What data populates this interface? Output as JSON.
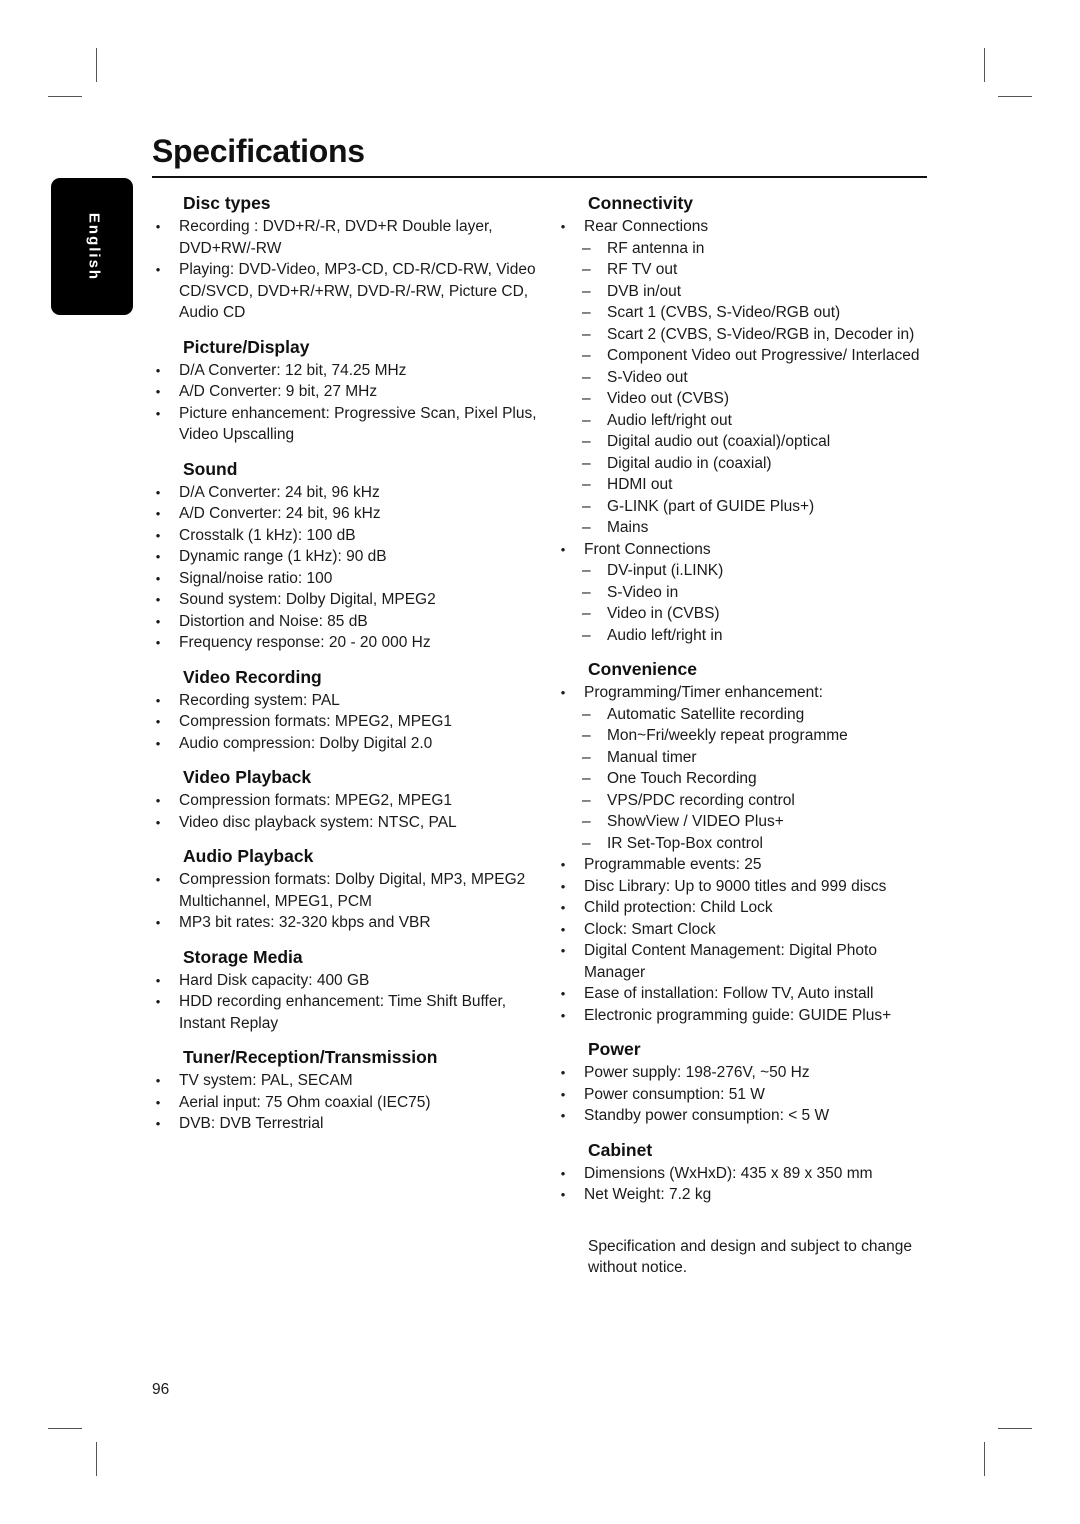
{
  "page": {
    "title": "Specifications",
    "language_tab": "English",
    "page_number": "96",
    "note": "Specification and design and subject to change without notice."
  },
  "left_sections": [
    {
      "heading": "Disc types",
      "items": [
        {
          "text": "Recording : DVD+R/-R, DVD+R Double layer, DVD+RW/-RW"
        },
        {
          "text": "Playing: DVD-Video, MP3-CD, CD-R/CD-RW, Video CD/SVCD, DVD+R/+RW, DVD-R/-RW, Picture CD, Audio CD"
        }
      ]
    },
    {
      "heading": "Picture/Display",
      "items": [
        {
          "text": "D/A Converter: 12 bit, 74.25 MHz"
        },
        {
          "text": "A/D Converter: 9 bit, 27 MHz"
        },
        {
          "text": "Picture enhancement: Progressive Scan, Pixel Plus, Video Upscalling"
        }
      ]
    },
    {
      "heading": "Sound",
      "items": [
        {
          "text": "D/A Converter: 24 bit, 96 kHz"
        },
        {
          "text": "A/D Converter: 24 bit, 96 kHz"
        },
        {
          "text": "Crosstalk (1 kHz): 100 dB"
        },
        {
          "text": "Dynamic range (1 kHz): 90 dB"
        },
        {
          "text": "Signal/noise ratio: 100"
        },
        {
          "text": "Sound system: Dolby Digital, MPEG2"
        },
        {
          "text": "Distortion and Noise: 85 dB"
        },
        {
          "text": "Frequency response: 20 - 20 000 Hz"
        }
      ]
    },
    {
      "heading": "Video Recording",
      "items": [
        {
          "text": "Recording system: PAL"
        },
        {
          "text": "Compression formats: MPEG2, MPEG1"
        },
        {
          "text": "Audio compression: Dolby Digital 2.0"
        }
      ]
    },
    {
      "heading": "Video Playback",
      "items": [
        {
          "text": "Compression formats: MPEG2, MPEG1"
        },
        {
          "text": "Video disc playback system: NTSC, PAL"
        }
      ]
    },
    {
      "heading": "Audio Playback",
      "items": [
        {
          "text": "Compression formats: Dolby Digital, MP3, MPEG2 Multichannel, MPEG1, PCM"
        },
        {
          "text": "MP3 bit rates: 32-320 kbps and VBR"
        }
      ]
    },
    {
      "heading": "Storage Media",
      "items": [
        {
          "text": "Hard Disk capacity: 400 GB"
        },
        {
          "text": "HDD recording enhancement: Time Shift Buffer, Instant Replay"
        }
      ]
    },
    {
      "heading": "Tuner/Reception/Transmission",
      "items": [
        {
          "text": "TV system: PAL, SECAM"
        },
        {
          "text": "Aerial input: 75 Ohm coaxial (IEC75)"
        },
        {
          "text": "DVB: DVB Terrestrial"
        }
      ]
    }
  ],
  "right_sections": [
    {
      "heading": "Connectivity",
      "items": [
        {
          "text": "Rear Connections",
          "sub": [
            "RF antenna in",
            "RF TV out",
            "DVB in/out",
            "Scart 1 (CVBS, S-Video/RGB out)",
            "Scart 2 (CVBS, S-Video/RGB in, Decoder in)",
            "Component Video out Progressive/ Interlaced",
            "S-Video out",
            "Video out (CVBS)",
            "Audio left/right out",
            "Digital audio out (coaxial)/optical",
            "Digital audio in (coaxial)",
            "HDMI out",
            "G-LINK (part of GUIDE Plus+)",
            "Mains"
          ]
        },
        {
          "text": "Front Connections",
          "sub": [
            "DV-input (i.LINK)",
            "S-Video in",
            "Video in (CVBS)",
            "Audio left/right in"
          ]
        }
      ]
    },
    {
      "heading": "Convenience",
      "items": [
        {
          "text": "Programming/Timer enhancement:",
          "sub": [
            "Automatic Satellite recording",
            "Mon~Fri/weekly repeat programme",
            "Manual timer",
            "One Touch Recording",
            "VPS/PDC recording control",
            "ShowView / VIDEO Plus+",
            "IR Set-Top-Box control"
          ]
        },
        {
          "text": "Programmable events: 25"
        },
        {
          "text": "Disc Library: Up to 9000 titles and 999 discs"
        },
        {
          "text": "Child protection: Child Lock"
        },
        {
          "text": "Clock: Smart Clock"
        },
        {
          "text": "Digital Content Management: Digital Photo Manager"
        },
        {
          "text": "Ease of installation: Follow TV, Auto install"
        },
        {
          "text": "Electronic programming guide: GUIDE Plus+"
        }
      ]
    },
    {
      "heading": "Power",
      "items": [
        {
          "text": "Power supply: 198-276V, ~50 Hz"
        },
        {
          "text": "Power consumption: 51 W"
        },
        {
          "text": "Standby power consumption: < 5 W"
        }
      ]
    },
    {
      "heading": "Cabinet",
      "items": [
        {
          "text": "Dimensions (WxHxD): 435 x 89 x 350 mm"
        },
        {
          "text": "Net Weight: 7.2 kg"
        }
      ]
    }
  ]
}
